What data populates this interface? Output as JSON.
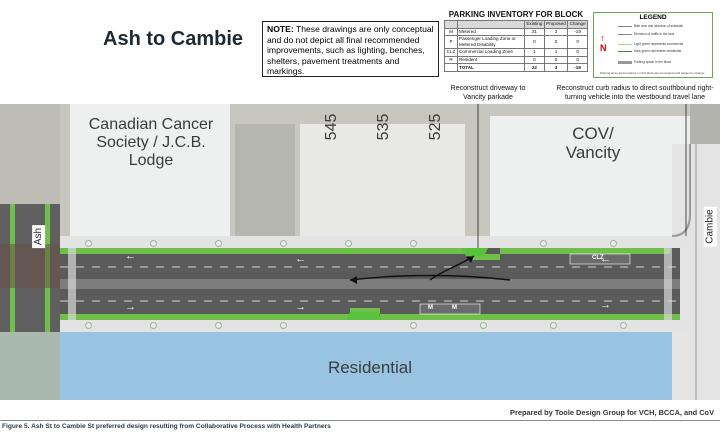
{
  "title": "Ash to Cambie",
  "note": {
    "label": "NOTE:",
    "text": "These drawings are only conceptual and do not depict all final recommended improvements, such as lighting, benches, shelters, pavement treatments and markings."
  },
  "parking_inventory": {
    "title": "PARKING INVENTORY FOR BLOCK",
    "columns": [
      "",
      "",
      "Existing",
      "Proposed",
      "Change"
    ],
    "rows": [
      {
        "code": "M",
        "label": "Metered",
        "existing": "21",
        "proposed": "2",
        "change": "-19"
      },
      {
        "code": "P",
        "label": "Passenger Loading Zone or Metered Disability",
        "existing": "0",
        "proposed": "0",
        "change": "0"
      },
      {
        "code": "CLZ",
        "label": "Commercial Loading Zone",
        "existing": "1",
        "proposed": "1",
        "change": "0"
      },
      {
        "code": "R",
        "label": "Resident",
        "existing": "0",
        "proposed": "0",
        "change": "0"
      }
    ],
    "total": {
      "code": "",
      "label": "TOTAL",
      "existing": "22",
      "proposed": "3",
      "change": "-19"
    }
  },
  "legend": {
    "title": "LEGEND",
    "items": [
      "Bike lane and direction of sidewalk",
      "Direction of traffic in the lane",
      "Light green represents commercial",
      "Dark green represents residential",
      "Parking space in the block"
    ],
    "footnote": "Parking sizes and locations on this block are conceptual and subject to change"
  },
  "buildings": {
    "cancer_society": "Canadian Cancer Society / J.C.B. Lodge",
    "b545": "545",
    "b535": "535",
    "b525": "525",
    "cov": "COV/ Vancity",
    "residential": "Residential"
  },
  "streets": {
    "ash": "Ash",
    "cambie": "Cambie"
  },
  "callouts": {
    "driveway": "Reconstruct driveway to Vancity parkade",
    "curb": "Reconstruct curb radius to direct southbound right-turning vehicle into the westbound travel lane"
  },
  "markings": {
    "metered": "M",
    "clz": "CLZ"
  },
  "credit": "Prepared by Toole Design Group for VCH, BCCA, and CoV",
  "caption": "Figure 5.  Ash St to Cambie St preferred design resulting from Collaborative Process with Health Partners",
  "colors": {
    "bike_lane": "#6fbf4a",
    "road": "#5a5a5a",
    "residential": "#8fc3e8",
    "sidewalk": "#e3e3e3"
  }
}
